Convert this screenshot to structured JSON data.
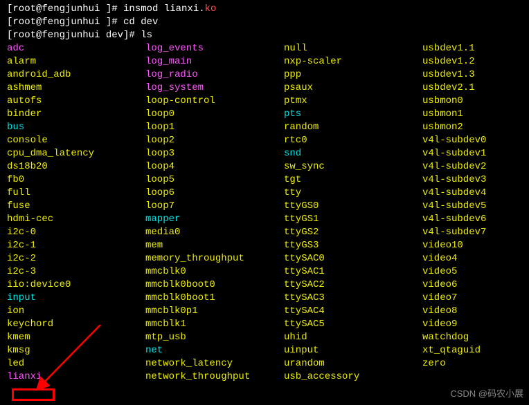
{
  "prompts": [
    {
      "prefix": "[root@fengjunhui ]# ",
      "cmd": "insmod lianxi.",
      "cmd_suffix": "ko"
    },
    {
      "prefix": "[root@fengjunhui ]# ",
      "cmd": "cd dev",
      "cmd_suffix": ""
    },
    {
      "prefix": "[root@fengjunhui dev]# ",
      "cmd": "ls",
      "cmd_suffix": ""
    }
  ],
  "entries": [
    {
      "t": "adc",
      "c": "magenta"
    },
    {
      "t": "log_events",
      "c": "magenta"
    },
    {
      "t": "null",
      "c": "yellow"
    },
    {
      "t": "usbdev1.1",
      "c": "yellow"
    },
    {
      "t": "alarm",
      "c": "yellow"
    },
    {
      "t": "log_main",
      "c": "magenta"
    },
    {
      "t": "nxp-scaler",
      "c": "yellow"
    },
    {
      "t": "usbdev1.2",
      "c": "yellow"
    },
    {
      "t": "android_adb",
      "c": "yellow"
    },
    {
      "t": "log_radio",
      "c": "magenta"
    },
    {
      "t": "ppp",
      "c": "yellow"
    },
    {
      "t": "usbdev1.3",
      "c": "yellow"
    },
    {
      "t": "ashmem",
      "c": "yellow"
    },
    {
      "t": "log_system",
      "c": "magenta"
    },
    {
      "t": "psaux",
      "c": "yellow"
    },
    {
      "t": "usbdev2.1",
      "c": "yellow"
    },
    {
      "t": "autofs",
      "c": "yellow"
    },
    {
      "t": "loop-control",
      "c": "yellow"
    },
    {
      "t": "ptmx",
      "c": "yellow"
    },
    {
      "t": "usbmon0",
      "c": "yellow"
    },
    {
      "t": "binder",
      "c": "yellow"
    },
    {
      "t": "loop0",
      "c": "yellow"
    },
    {
      "t": "pts",
      "c": "cyan"
    },
    {
      "t": "usbmon1",
      "c": "yellow"
    },
    {
      "t": "bus",
      "c": "cyan"
    },
    {
      "t": "loop1",
      "c": "yellow"
    },
    {
      "t": "random",
      "c": "yellow"
    },
    {
      "t": "usbmon2",
      "c": "yellow"
    },
    {
      "t": "console",
      "c": "yellow"
    },
    {
      "t": "loop2",
      "c": "yellow"
    },
    {
      "t": "rtc0",
      "c": "yellow"
    },
    {
      "t": "v4l-subdev0",
      "c": "yellow"
    },
    {
      "t": "cpu_dma_latency",
      "c": "yellow"
    },
    {
      "t": "loop3",
      "c": "yellow"
    },
    {
      "t": "snd",
      "c": "cyan"
    },
    {
      "t": "v4l-subdev1",
      "c": "yellow"
    },
    {
      "t": "ds18b20",
      "c": "yellow"
    },
    {
      "t": "loop4",
      "c": "yellow"
    },
    {
      "t": "sw_sync",
      "c": "yellow"
    },
    {
      "t": "v4l-subdev2",
      "c": "yellow"
    },
    {
      "t": "fb0",
      "c": "yellow"
    },
    {
      "t": "loop5",
      "c": "yellow"
    },
    {
      "t": "tgt",
      "c": "yellow"
    },
    {
      "t": "v4l-subdev3",
      "c": "yellow"
    },
    {
      "t": "full",
      "c": "yellow"
    },
    {
      "t": "loop6",
      "c": "yellow"
    },
    {
      "t": "tty",
      "c": "yellow"
    },
    {
      "t": "v4l-subdev4",
      "c": "yellow"
    },
    {
      "t": "fuse",
      "c": "yellow"
    },
    {
      "t": "loop7",
      "c": "yellow"
    },
    {
      "t": "ttyGS0",
      "c": "yellow"
    },
    {
      "t": "v4l-subdev5",
      "c": "yellow"
    },
    {
      "t": "hdmi-cec",
      "c": "yellow"
    },
    {
      "t": "mapper",
      "c": "cyan"
    },
    {
      "t": "ttyGS1",
      "c": "yellow"
    },
    {
      "t": "v4l-subdev6",
      "c": "yellow"
    },
    {
      "t": "i2c-0",
      "c": "yellow"
    },
    {
      "t": "media0",
      "c": "yellow"
    },
    {
      "t": "ttyGS2",
      "c": "yellow"
    },
    {
      "t": "v4l-subdev7",
      "c": "yellow"
    },
    {
      "t": "i2c-1",
      "c": "yellow"
    },
    {
      "t": "mem",
      "c": "yellow"
    },
    {
      "t": "ttyGS3",
      "c": "yellow"
    },
    {
      "t": "video10",
      "c": "yellow"
    },
    {
      "t": "i2c-2",
      "c": "yellow"
    },
    {
      "t": "memory_throughput",
      "c": "yellow"
    },
    {
      "t": "ttySAC0",
      "c": "yellow"
    },
    {
      "t": "video4",
      "c": "yellow"
    },
    {
      "t": "i2c-3",
      "c": "yellow"
    },
    {
      "t": "mmcblk0",
      "c": "yellow"
    },
    {
      "t": "ttySAC1",
      "c": "yellow"
    },
    {
      "t": "video5",
      "c": "yellow"
    },
    {
      "t": "iio:device0",
      "c": "yellow"
    },
    {
      "t": "mmcblk0boot0",
      "c": "yellow"
    },
    {
      "t": "ttySAC2",
      "c": "yellow"
    },
    {
      "t": "video6",
      "c": "yellow"
    },
    {
      "t": "input",
      "c": "cyan"
    },
    {
      "t": "mmcblk0boot1",
      "c": "yellow"
    },
    {
      "t": "ttySAC3",
      "c": "yellow"
    },
    {
      "t": "video7",
      "c": "yellow"
    },
    {
      "t": "ion",
      "c": "yellow"
    },
    {
      "t": "mmcblk0p1",
      "c": "yellow"
    },
    {
      "t": "ttySAC4",
      "c": "yellow"
    },
    {
      "t": "video8",
      "c": "yellow"
    },
    {
      "t": "keychord",
      "c": "yellow"
    },
    {
      "t": "mmcblk1",
      "c": "yellow"
    },
    {
      "t": "ttySAC5",
      "c": "yellow"
    },
    {
      "t": "video9",
      "c": "yellow"
    },
    {
      "t": "kmem",
      "c": "yellow"
    },
    {
      "t": "mtp_usb",
      "c": "yellow"
    },
    {
      "t": "uhid",
      "c": "yellow"
    },
    {
      "t": "watchdog",
      "c": "yellow"
    },
    {
      "t": "kmsg",
      "c": "yellow"
    },
    {
      "t": "net",
      "c": "cyan"
    },
    {
      "t": "uinput",
      "c": "yellow"
    },
    {
      "t": "xt_qtaguid",
      "c": "yellow"
    },
    {
      "t": "led",
      "c": "yellow"
    },
    {
      "t": "network_latency",
      "c": "yellow"
    },
    {
      "t": "urandom",
      "c": "yellow"
    },
    {
      "t": "zero",
      "c": "yellow"
    },
    {
      "t": "lianxi",
      "c": "magenta"
    },
    {
      "t": "network_throughput",
      "c": "yellow"
    },
    {
      "t": "usb_accessory",
      "c": "yellow"
    },
    {
      "t": "",
      "c": "yellow"
    }
  ],
  "watermark": "CSDN @码农小展"
}
